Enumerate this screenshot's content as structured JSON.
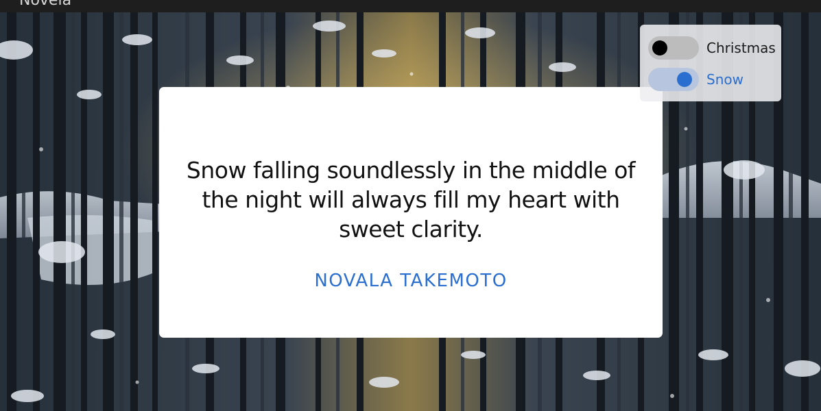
{
  "header": {
    "label": "Novela"
  },
  "toggles": [
    {
      "label": "Christmas",
      "state": "off"
    },
    {
      "label": "Snow",
      "state": "on"
    }
  ],
  "quote": {
    "text": "Snow falling soundlessly in the middle of the night will always fill my heart with sweet clarity.",
    "author": "NOVALA TAKEMOTO"
  },
  "colors": {
    "accent": "#2a6ecf",
    "card": "#ffffff",
    "topbar": "#1e1e1e"
  }
}
